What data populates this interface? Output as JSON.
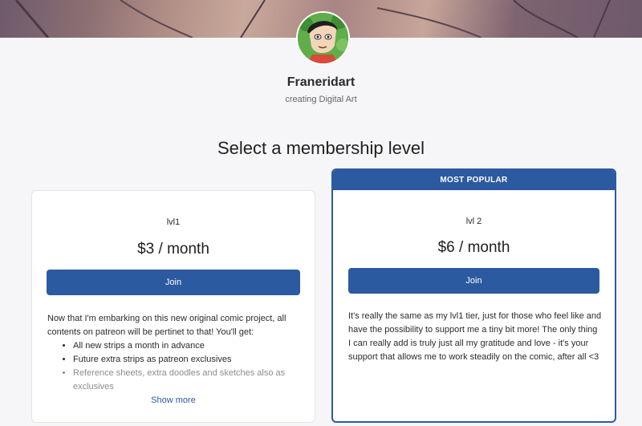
{
  "creator": {
    "name": "Franeridart",
    "tagline": "creating Digital Art"
  },
  "icons": {
    "avatar": "creator-avatar-cartoon",
    "bullet": "disc"
  },
  "colors": {
    "accent": "#2c5aa0",
    "page_background": "#f6f6f8"
  },
  "section_title": "Select a membership level",
  "tiers": [
    {
      "badge": "",
      "name": "lvl1",
      "price": "$3 / month",
      "join_label": "Join",
      "description": "Now that I'm embarking on this new original comic project, all contents on patreon will be pertinet to that! You'll get:",
      "benefits": [
        "All new strips a month in advance",
        "Future extra strips as patreon exclusives",
        "Reference sheets, extra doodles and sketches also as exclusives"
      ],
      "show_more_label": "Show more"
    },
    {
      "badge": "MOST POPULAR",
      "name": "lvl 2",
      "price": "$6 / month",
      "join_label": "Join",
      "description": "It's really the same as my lvl1 tier, just for those who feel like and have the possibility to support me a tiny bit more! The only thing I can really add is truly just all my gratitude and love - it's your support that allows me to work steadily on the comic, after all <3"
    }
  ]
}
